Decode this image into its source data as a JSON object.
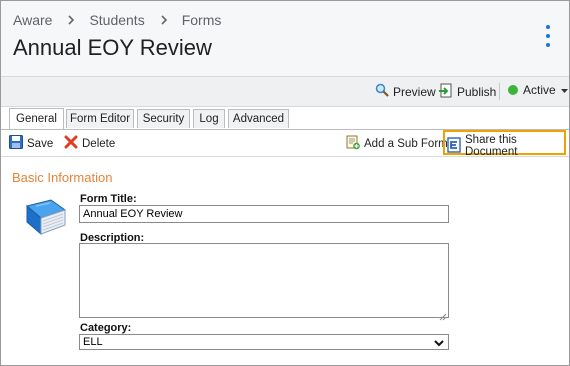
{
  "breadcrumb": {
    "items": [
      "Aware",
      "Students",
      "Forms"
    ]
  },
  "page": {
    "title": "Annual EOY Review"
  },
  "actions": {
    "preview": "Preview",
    "publish": "Publish",
    "status": "Active"
  },
  "tabs": [
    "General",
    "Form Editor",
    "Security",
    "Log",
    "Advanced"
  ],
  "toolbar": {
    "save": "Save",
    "delete": "Delete",
    "add_sub_form": "Add a Sub Form",
    "share": "Share this Document"
  },
  "section": {
    "title": "Basic Information"
  },
  "form": {
    "title_label": "Form Title:",
    "title_value": "Annual EOY Review",
    "description_label": "Description:",
    "description_value": "",
    "category_label": "Category:",
    "category_value": "ELL"
  },
  "colors": {
    "accent": "#1a73e8",
    "section": "#e8833a",
    "highlight": "#f0a300",
    "active_dot": "#3cb43c"
  },
  "icons": [
    "magnifier-icon",
    "publish-icon",
    "status-dot-icon",
    "caret-down-icon",
    "save-disk-icon",
    "delete-x-icon",
    "add-sub-form-icon",
    "share-document-icon",
    "book-icon",
    "kebab-menu-icon"
  ]
}
